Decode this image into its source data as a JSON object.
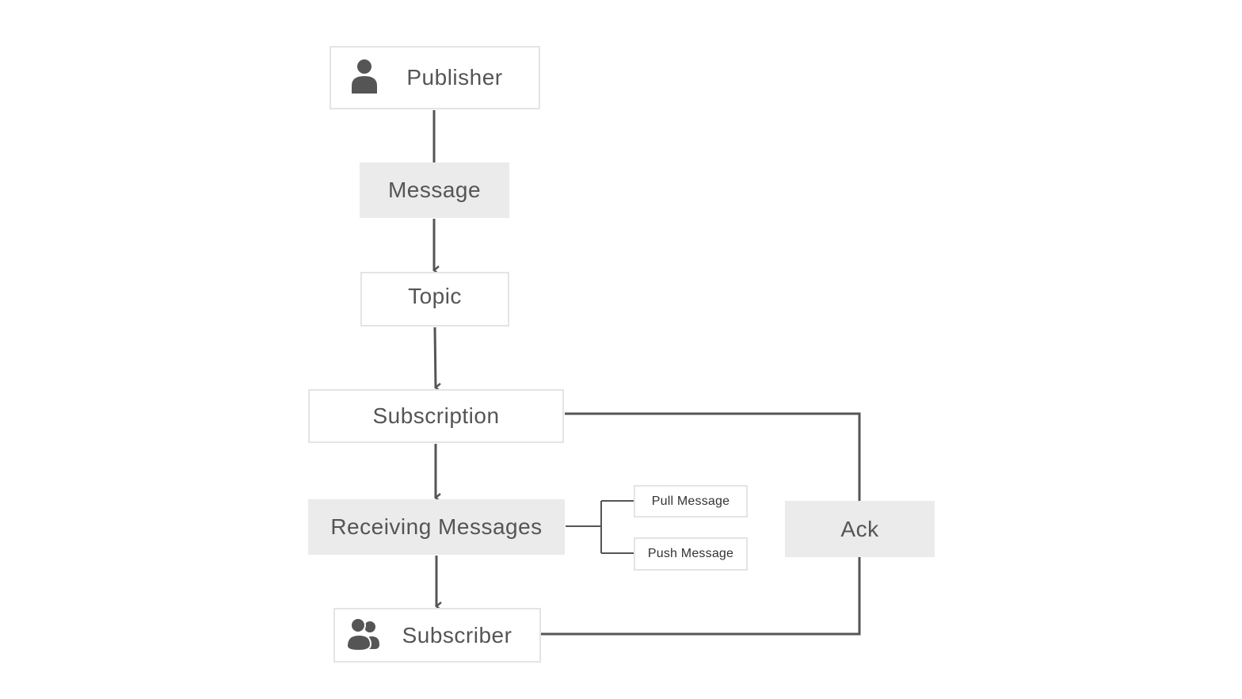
{
  "nodes": {
    "publisher": {
      "label": "Publisher",
      "icon": "person-icon"
    },
    "message": {
      "label": "Message"
    },
    "topic": {
      "label": "Topic"
    },
    "subscription": {
      "label": "Subscription"
    },
    "receiving": {
      "label": "Receiving Messages"
    },
    "subscriber": {
      "label": "Subscriber",
      "icon": "group-icon"
    },
    "pull": {
      "label": "Pull Message"
    },
    "push": {
      "label": "Push Message"
    },
    "ack": {
      "label": "Ack"
    }
  },
  "colors": {
    "line": "#555555",
    "gray_fill": "#ebebeb",
    "border": "#e4e4e4",
    "text": "#555555"
  }
}
